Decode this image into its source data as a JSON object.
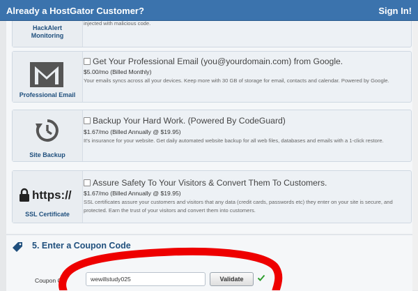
{
  "header": {
    "title": "Already a HostGator Customer?",
    "signin": "Sign In!"
  },
  "addons": [
    {
      "icon": "hackalert-icon",
      "label_line1": "HackAlert",
      "label_line2": "Monitoring",
      "desc": "injected with malicious code."
    },
    {
      "icon": "gmail-envelope-icon",
      "label": "Professional Email",
      "heading": "Get Your Professional Email (you@yourdomain.com) from Google.",
      "price": "$5.00/mo (Billed Monthly)",
      "desc": "Your emails syncs across all your devices. Keep more with 30 GB of storage for email, contacts and calendar. Powered by Google."
    },
    {
      "icon": "backup-history-icon",
      "label": "Site Backup",
      "heading": "Backup Your Hard Work. (Powered By CodeGuard)",
      "price": "$1.67/mo (Billed Annually @ $19.95)",
      "desc": "It's insurance for your website. Get daily automated website backup for all web files, databases and emails with a 1-click restore."
    },
    {
      "icon": "padlock-icon",
      "icon_text": "https://",
      "label": "SSL Certificate",
      "heading": "Assure Safety To Your Visitors & Convert Them To Customers.",
      "price": "$1.67/mo (Billed Annually @ $19.95)",
      "desc": "SSL certificates assure your customers and visitors that any data (credit cards, passwords etc) they enter on your site is secure, and protected. Earn the trust of your visitors and convert them into customers."
    }
  ],
  "coupon": {
    "section_title": "5. Enter a Coupon Code",
    "label": "Coupon Co",
    "value": "wewillstudy025",
    "button": "Validate"
  },
  "colors": {
    "header_bg": "#3b73ad",
    "link_blue": "#1f4f7d",
    "check_green": "#2e9e2e",
    "annotation_red": "#ee0000"
  }
}
